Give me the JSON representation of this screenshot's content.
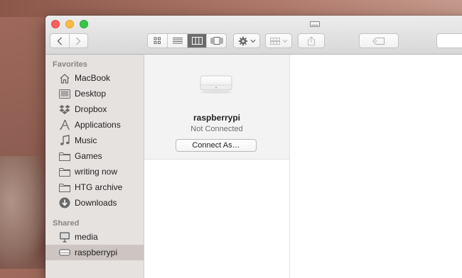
{
  "toolbar": {
    "back_icon": "chevron-left-icon",
    "forward_icon": "chevron-right-icon",
    "views": [
      "icon-view-icon",
      "list-view-icon",
      "column-view-icon",
      "cover-flow-icon"
    ],
    "active_view": "column-view-icon",
    "action_icon": "gear-icon",
    "arrange_icon": "arrange-icon",
    "share_icon": "share-icon",
    "tag_icon": "tag-icon"
  },
  "sidebar": {
    "favorites_label": "Favorites",
    "favorites": [
      {
        "label": "MacBook",
        "icon": "home-icon"
      },
      {
        "label": "Desktop",
        "icon": "desktop-icon"
      },
      {
        "label": "Dropbox",
        "icon": "dropbox-icon"
      },
      {
        "label": "Applications",
        "icon": "applications-icon"
      },
      {
        "label": "Music",
        "icon": "music-icon"
      },
      {
        "label": "Games",
        "icon": "folder-icon"
      },
      {
        "label": "writing now",
        "icon": "folder-icon"
      },
      {
        "label": "HTG archive",
        "icon": "folder-icon"
      },
      {
        "label": "Downloads",
        "icon": "downloads-icon"
      }
    ],
    "shared_label": "Shared",
    "shared": [
      {
        "label": "media",
        "icon": "computer-icon"
      },
      {
        "label": "raspberrypi",
        "icon": "network-drive-icon",
        "selected": true
      }
    ]
  },
  "device": {
    "name": "raspberrypi",
    "status": "Not Connected",
    "connect_label": "Connect As…"
  },
  "colors": {
    "sidebar_bg": "#e6e2e0",
    "selected_bg": "#cdc5c2",
    "close": "#fc605b",
    "minimize": "#fdbc40",
    "maximize": "#34c84a"
  }
}
